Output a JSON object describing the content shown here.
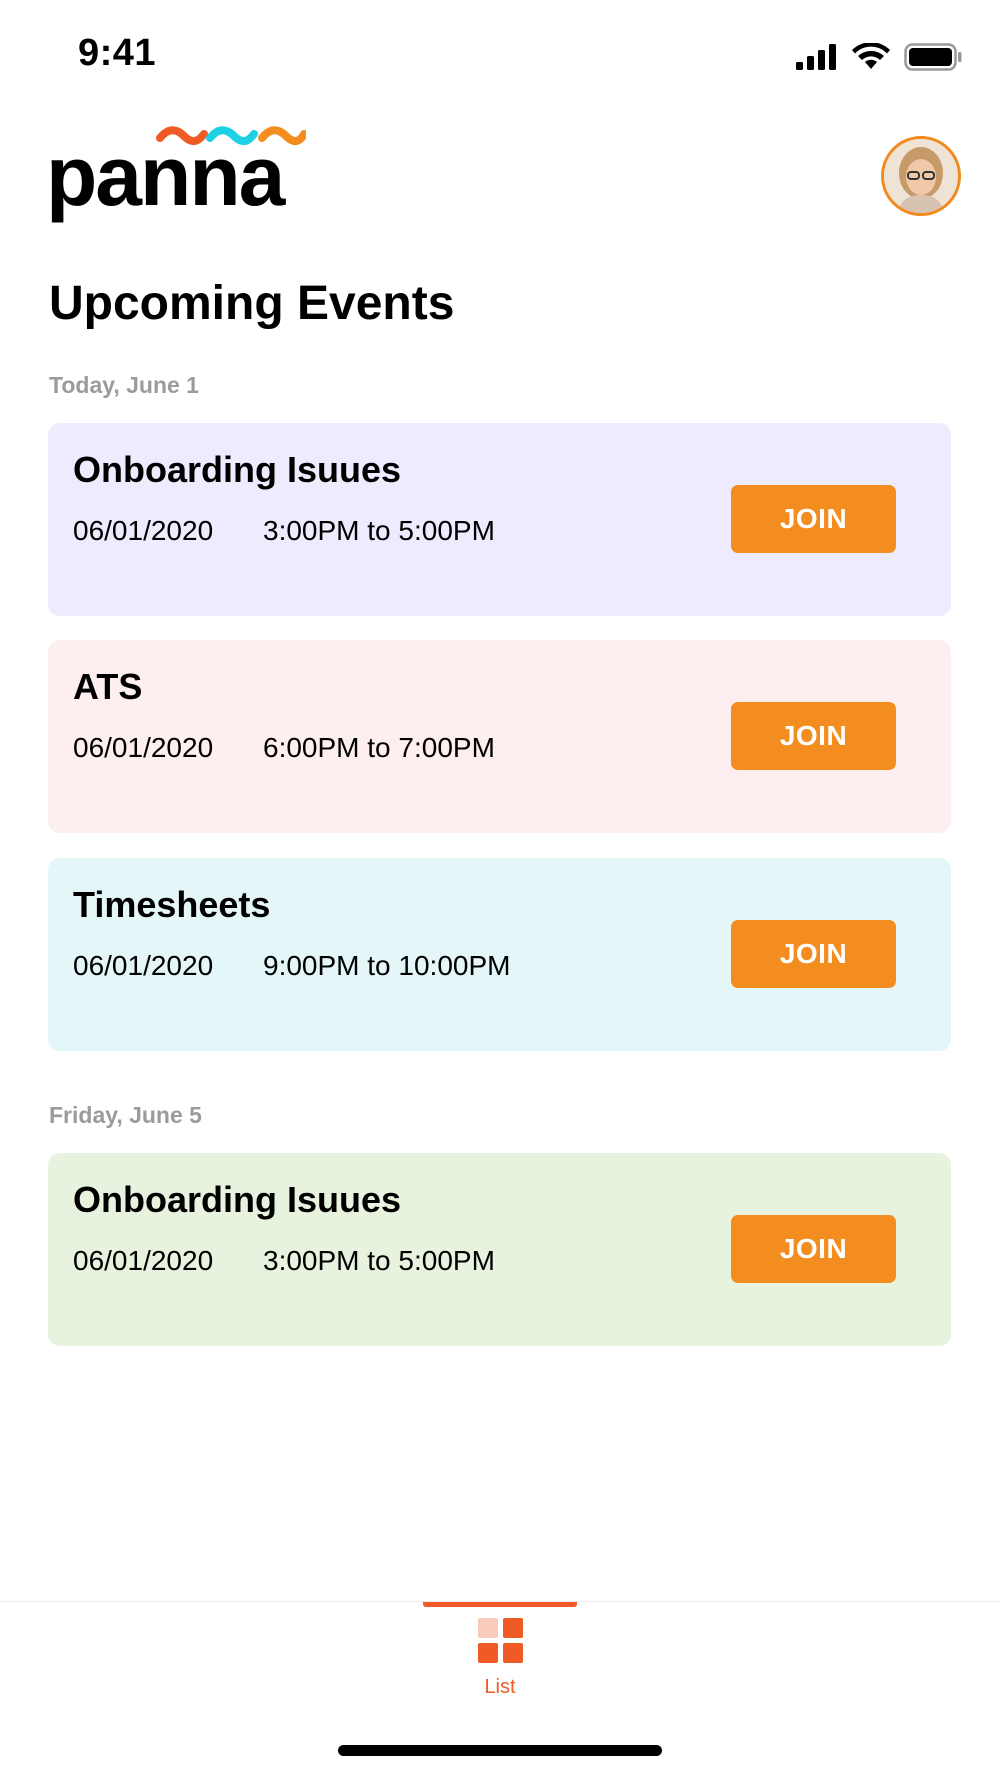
{
  "status_bar": {
    "time": "9:41"
  },
  "header": {
    "logo_text": "panna",
    "logo_tilde_colors": [
      "#f05a24",
      "#1ed0e3",
      "#f48d1f"
    ]
  },
  "page": {
    "title": "Upcoming Events"
  },
  "groups": [
    {
      "day_label": "Today, June 1",
      "events": [
        {
          "title": "Onboarding Isuues",
          "date": "06/01/2020",
          "time": "3:00PM to 5:00PM",
          "button": "JOIN",
          "bg": "#edebfd"
        },
        {
          "title": "ATS",
          "date": "06/01/2020",
          "time": "6:00PM to 7:00PM",
          "button": "JOIN",
          "bg": "#fdeeef"
        },
        {
          "title": "Timesheets",
          "date": "06/01/2020",
          "time": "9:00PM to 10:00PM",
          "button": "JOIN",
          "bg": "#e4f6f8"
        }
      ]
    },
    {
      "day_label": "Friday, June 5",
      "events": [
        {
          "title": "Onboarding Isuues",
          "date": "06/01/2020",
          "time": "3:00PM to 5:00PM",
          "button": "JOIN",
          "bg": "#e7f3de"
        }
      ]
    }
  ],
  "tab_bar": {
    "tabs": [
      {
        "label": "List",
        "icon": "grid-icon",
        "active": true
      }
    ],
    "accent": "#f05a24"
  },
  "colors": {
    "join_button": "#f48d1f",
    "day_label": "#9b9b9b"
  }
}
